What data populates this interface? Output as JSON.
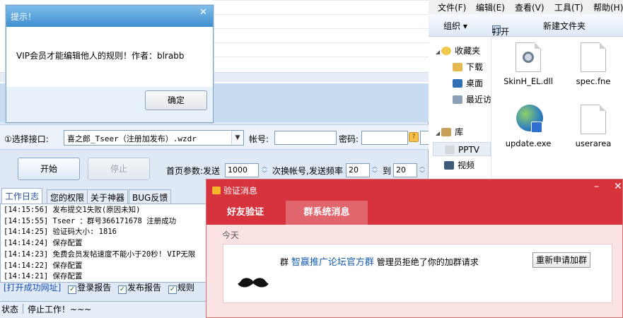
{
  "app": {
    "interface_label": "①选择接口:",
    "interface_value": "喜之郎_Tseer（注册加发布）.wzdr",
    "account_label": "帐号:",
    "account_value": "",
    "password_label": "密码:",
    "password_value": "",
    "help_glyph": "?",
    "start_label": "开始",
    "stop_label": "停止",
    "home_param_label": "首页参数:发送",
    "send_count": "1000",
    "switch_label": "次换帐号,发送频率",
    "freq_from": "20",
    "to_label": "到",
    "freq_to": "20",
    "tabs": [
      "工作日志",
      "您的权限",
      "关于神器",
      "BUG反馈"
    ],
    "log": [
      "[14:15:56] 发布提交1失败(原因未知)",
      "[14:15:55] Tseer ：群号366171678 注册成功",
      "[14:14:25] 验证码大小: 1816",
      "[14:14:24] 保存配置",
      "[14:14:23] 免费会员发帖速度不能小于20秒! VIP无限",
      "[14:14:22] 保存配置",
      "[14:14:21] 保存配置"
    ],
    "footer_link": "[打开成功网址]",
    "footer_checks": [
      "登录报告",
      "发布报告",
      "规则"
    ],
    "status_label": "状态",
    "status_text": "停止工作！~~~"
  },
  "dialog": {
    "title": "提示！",
    "close_glyph": "✕",
    "message": "VIP会员才能编辑他人的规则！作者：blrabb",
    "ok_label": "确定"
  },
  "explorer": {
    "menu": [
      "文件(F)",
      "编辑(E)",
      "查看(V)",
      "工具(T)",
      "帮助(H)"
    ],
    "toolbar": {
      "organize": "组织 ▾",
      "open": "打开",
      "new_folder": "新建文件夹"
    },
    "nav": [
      {
        "label": "收藏夹",
        "icon": "star-icon"
      },
      {
        "label": "下载",
        "icon": "download-folder-icon"
      },
      {
        "label": "桌面",
        "icon": "desktop-icon"
      },
      {
        "label": "最近访",
        "icon": "recent-icon"
      },
      {
        "label": "库",
        "icon": "library-icon"
      },
      {
        "label": "PPTV",
        "icon": "pptv-icon"
      },
      {
        "label": "视频",
        "icon": "video-icon"
      }
    ],
    "files": [
      {
        "name": "SkinH_EL.dll",
        "icon": "dll-gear-icon"
      },
      {
        "name": "spec.fne",
        "icon": "blank-file-icon"
      },
      {
        "name": "update.exe",
        "icon": "globe-exe-icon"
      },
      {
        "name": "userarea",
        "icon": "blank-file-icon"
      }
    ]
  },
  "verify": {
    "title": "验证消息",
    "tabs": [
      "好友验证",
      "群系统消息"
    ],
    "today_label": "今天",
    "group_prefix": "群",
    "group_name": "智赢推广论坛官方群",
    "message": "管理员拒绝了你的加群请求",
    "reapply_label": "重新申请加群"
  },
  "colors": {
    "verify_red": "#d6333d",
    "dialog_title_blue": "#3f8fd0",
    "link_blue": "#1a4fb8"
  }
}
